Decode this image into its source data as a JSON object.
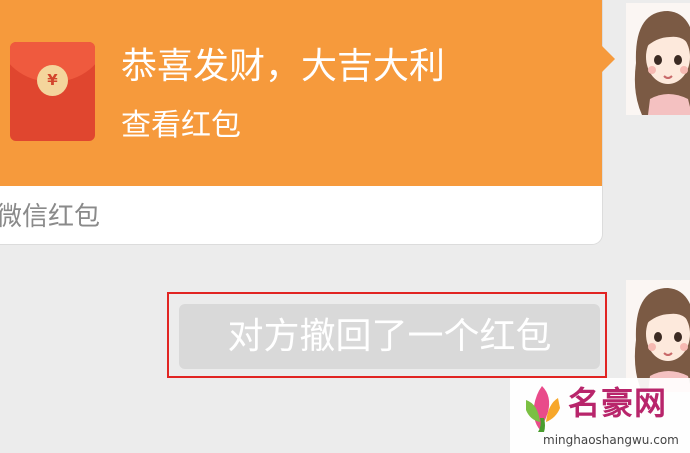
{
  "chat": {
    "red_packet": {
      "currency_symbol": "¥",
      "greeting": "恭喜发财，大吉大利",
      "action_label": "查看红包",
      "source_label": "微信红包"
    },
    "recall_notice": "对方撤回了一个红包"
  },
  "watermark": {
    "site_name": "名豪网",
    "site_url": "minghaoshangwu.com"
  },
  "colors": {
    "chat_background": "#ececec",
    "red_packet_orange": "#f69a3c",
    "envelope_red": "#e0462f",
    "highlight_red": "#e12422",
    "notice_gray": "#d9d9d9",
    "watermark_magenta": "#b8256b"
  },
  "icons": {
    "envelope": "red-envelope-icon",
    "avatar": "cartoon-girl-avatar"
  }
}
